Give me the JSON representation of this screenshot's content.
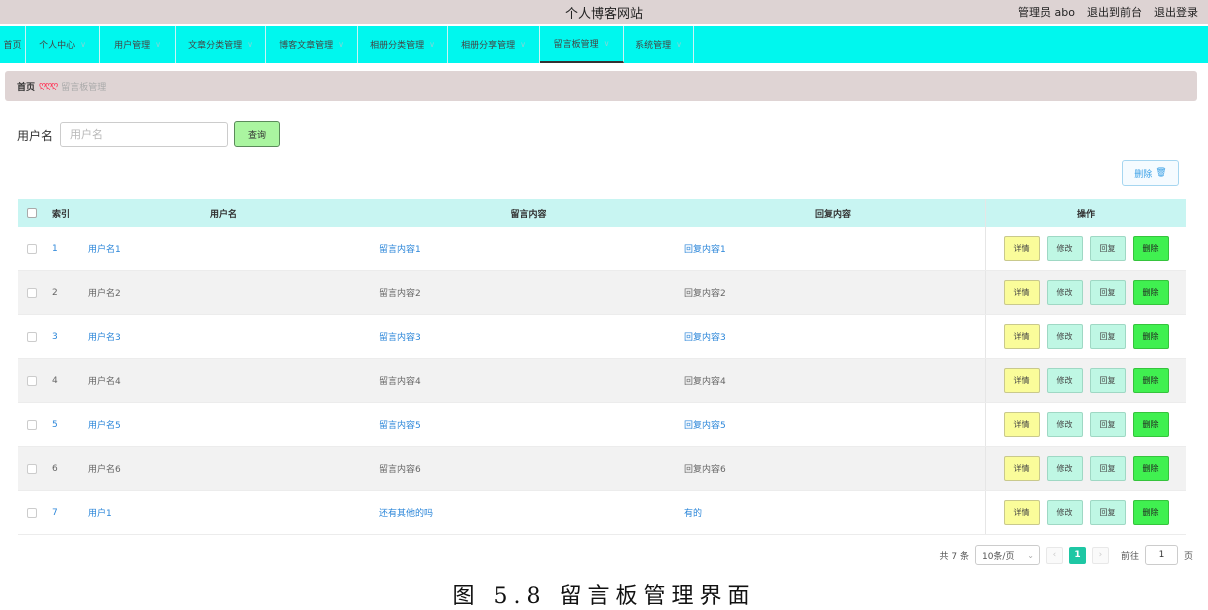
{
  "header": {
    "site_title": "个人博客网站",
    "admin_label": "管理员 abo",
    "to_front_label": "退出到前台",
    "logout_label": "退出登录"
  },
  "nav": {
    "items": [
      {
        "label": "首页",
        "chevron": false
      },
      {
        "label": "个人中心",
        "chevron": true
      },
      {
        "label": "用户管理",
        "chevron": true
      },
      {
        "label": "文章分类管理",
        "chevron": true
      },
      {
        "label": "博客文章管理",
        "chevron": true
      },
      {
        "label": "相册分类管理",
        "chevron": true
      },
      {
        "label": "相册分享管理",
        "chevron": true
      },
      {
        "label": "留言板管理",
        "chevron": true,
        "active": true
      },
      {
        "label": "系统管理",
        "chevron": true
      }
    ]
  },
  "breadcrumb": {
    "home": "首页",
    "separator": "ღღღ",
    "current": "留言板管理"
  },
  "search": {
    "label": "用户名",
    "placeholder": "用户名",
    "value": "",
    "query_label": "查询"
  },
  "toolbar": {
    "delete_label": "删除"
  },
  "table": {
    "headers": {
      "index": "索引",
      "username": "用户名",
      "message": "留言内容",
      "reply": "回复内容",
      "actions": "操作"
    },
    "rows": [
      {
        "index": "1",
        "username": "用户名1",
        "message": "留言内容1",
        "reply": "回复内容1"
      },
      {
        "index": "2",
        "username": "用户名2",
        "message": "留言内容2",
        "reply": "回复内容2"
      },
      {
        "index": "3",
        "username": "用户名3",
        "message": "留言内容3",
        "reply": "回复内容3"
      },
      {
        "index": "4",
        "username": "用户名4",
        "message": "留言内容4",
        "reply": "回复内容4"
      },
      {
        "index": "5",
        "username": "用户名5",
        "message": "留言内容5",
        "reply": "回复内容5"
      },
      {
        "index": "6",
        "username": "用户名6",
        "message": "留言内容6",
        "reply": "回复内容6"
      },
      {
        "index": "7",
        "username": "用户1",
        "message": "还有其他的吗",
        "reply": "有的"
      }
    ],
    "action_labels": {
      "detail": "详情",
      "edit": "修改",
      "reply": "回复",
      "delete": "删除"
    }
  },
  "pagination": {
    "total": "共 7 条",
    "page_size": "10条/页",
    "current_page": "1",
    "goto_label": "前往",
    "goto_value": "1",
    "page_unit": "页"
  },
  "caption": {
    "text": "图 5.8 留言板管理界面"
  },
  "colors": {
    "nav_bg": "#00f7ee",
    "header_bg": "#ddd3d3",
    "table_header_bg": "#c8f5f2",
    "pager_active": "#1ec7a4",
    "delete_btn": "#40f050",
    "detail_btn": "#fafc9a"
  }
}
